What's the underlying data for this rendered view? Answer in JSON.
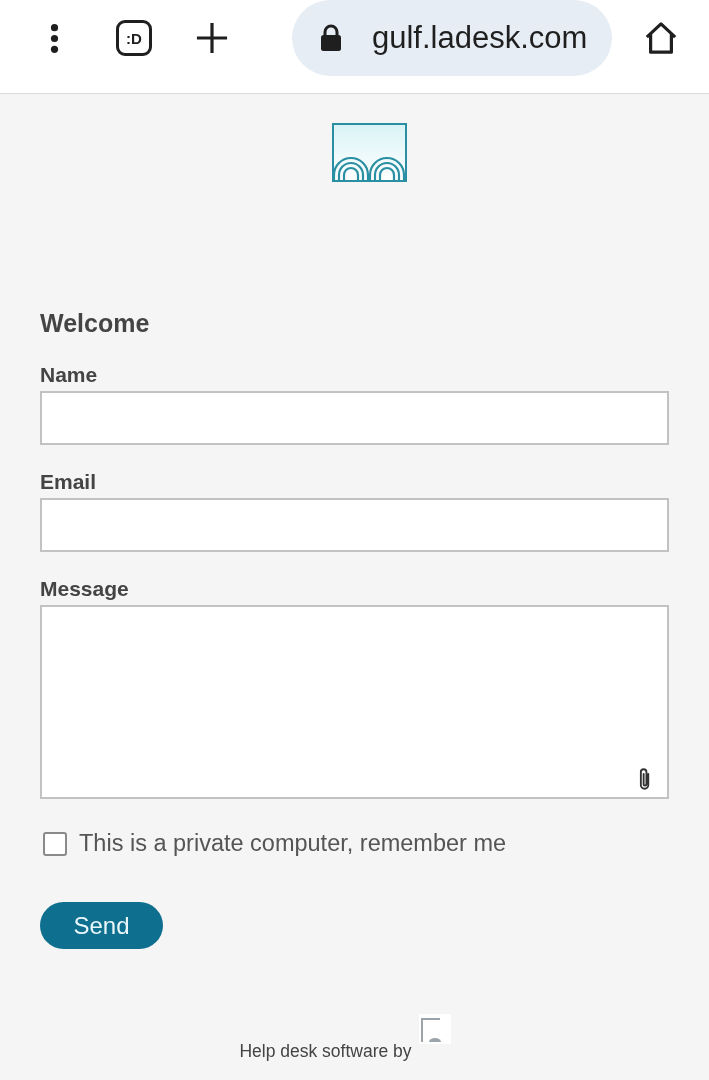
{
  "browser_bar": {
    "tab_switcher_label": ":D",
    "url": "gulf.ladesk.com",
    "secure": true
  },
  "form": {
    "heading": "Welcome",
    "fields": [
      {
        "kind": "input",
        "label": "Name"
      },
      {
        "kind": "input",
        "label": "Email"
      },
      {
        "kind": "textarea",
        "label": "Message",
        "attachment": true
      }
    ],
    "remember_checkbox": {
      "label": "This is a private computer, remember me",
      "checked": false
    },
    "submit_button": "Send"
  },
  "footer": {
    "text": "Help desk software by"
  }
}
